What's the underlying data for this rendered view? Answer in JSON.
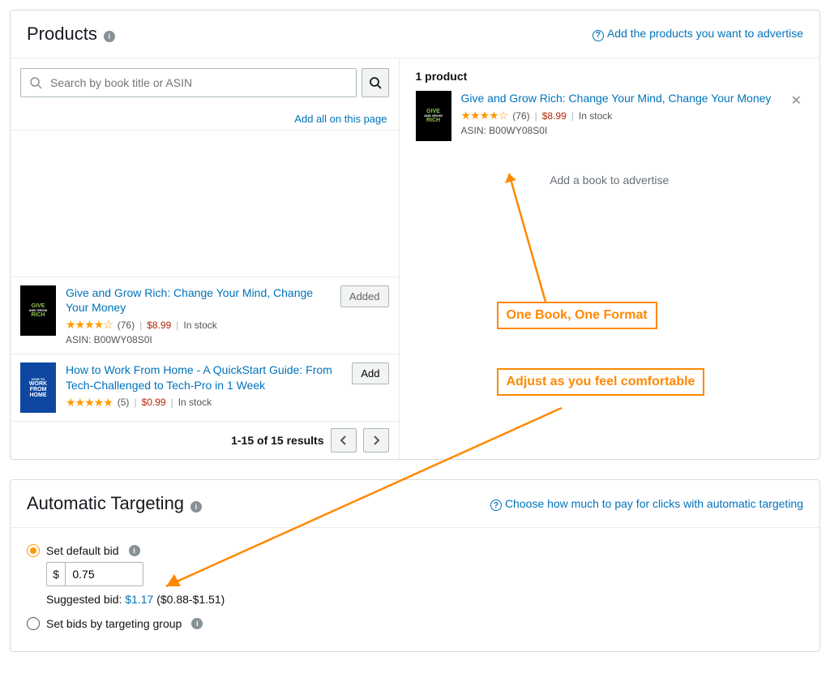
{
  "products": {
    "title": "Products",
    "help_link": "Add the products you want to advertise",
    "search_placeholder": "Search by book title or ASIN",
    "add_all_label": "Add all on this page",
    "results": [
      {
        "title": "Give and Grow Rich: Change Your Mind, Change Your Money",
        "reviews": "(76)",
        "price": "$8.99",
        "stock": "In stock",
        "asin": "ASIN: B00WY08S0I",
        "button": "Added",
        "added": true,
        "thumb_lines": [
          "GIVE",
          "AND GROW",
          "RICH"
        ],
        "thumb_variant": "green"
      },
      {
        "title": "How to Work From Home - A QuickStart Guide: From Tech-Challenged to Tech-Pro in 1 Week",
        "reviews": "(5)",
        "price": "$0.99",
        "stock": "In stock",
        "asin": "",
        "button": "Add",
        "added": false,
        "thumb_lines": [
          "HOW TO",
          "WORK FROM",
          "HOME"
        ],
        "thumb_variant": "blue"
      }
    ],
    "pagination": "1-15 of 15 results",
    "selected_count": "1 product",
    "selected": {
      "title": "Give and Grow Rich: Change Your Mind, Change Your Money",
      "reviews": "(76)",
      "price": "$8.99",
      "stock": "In stock",
      "asin": "ASIN: B00WY08S0I"
    },
    "add_book_hint": "Add a book to advertise"
  },
  "callouts": {
    "one_book": "One Book, One Format",
    "adjust": "Adjust as you feel comfortable"
  },
  "targeting": {
    "title": "Automatic Targeting",
    "help_link": "Choose how much to pay for clicks with automatic targeting",
    "option_default": "Set default bid",
    "currency": "$",
    "bid_value": "0.75",
    "suggested_label": "Suggested bid: ",
    "suggested_value": "$1.17",
    "suggested_range": " ($0.88-$1.51)",
    "option_group": "Set bids by targeting group"
  }
}
